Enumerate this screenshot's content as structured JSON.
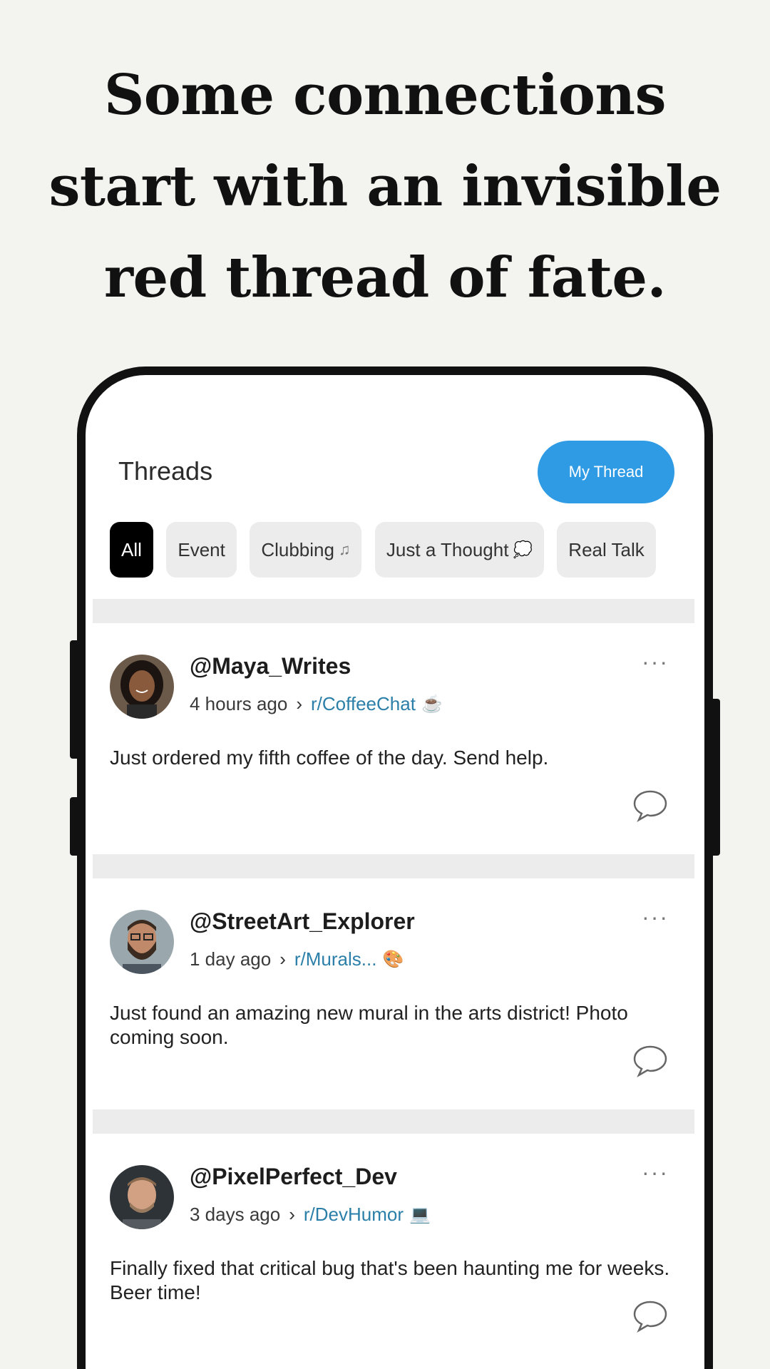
{
  "headline": {
    "line1": "Some connections",
    "line2": "start with an invisible",
    "line3": "red thread of fate."
  },
  "app": {
    "title": "Threads",
    "my_thread_label": "My Thread"
  },
  "filters": [
    {
      "label": "All",
      "active": true
    },
    {
      "label": "Event"
    },
    {
      "label": "Clubbing",
      "glyph": "♫"
    },
    {
      "label": "Just a Thought",
      "glyph": "💭"
    },
    {
      "label": "Real Talk"
    }
  ],
  "posts": [
    {
      "username": "@Maya_Writes",
      "time": "4 hours ago",
      "subreddit": "r/CoffeeChat",
      "emoji": "☕",
      "text": "Just ordered my fifth coffee of the day. Send help."
    },
    {
      "username": "@StreetArt_Explorer",
      "time": "1 day ago",
      "subreddit": "r/Murals...",
      "emoji": "🎨",
      "text": "Just found an amazing new mural in the arts district! Photo coming soon."
    },
    {
      "username": "@PixelPerfect_Dev",
      "time": "3 days ago",
      "subreddit": "r/DevHumor",
      "emoji": "💻",
      "text": "Finally fixed that critical bug that's been haunting me for weeks. Beer time!"
    }
  ],
  "icons": {
    "more": "more-options-icon",
    "comment": "comment-bubble-icon",
    "chevron": "chevron-right-icon"
  },
  "colors": {
    "background": "#f3f3ef",
    "accent": "#2f9be4",
    "subreddit": "#2b7fa8",
    "chip": "#ececec"
  }
}
